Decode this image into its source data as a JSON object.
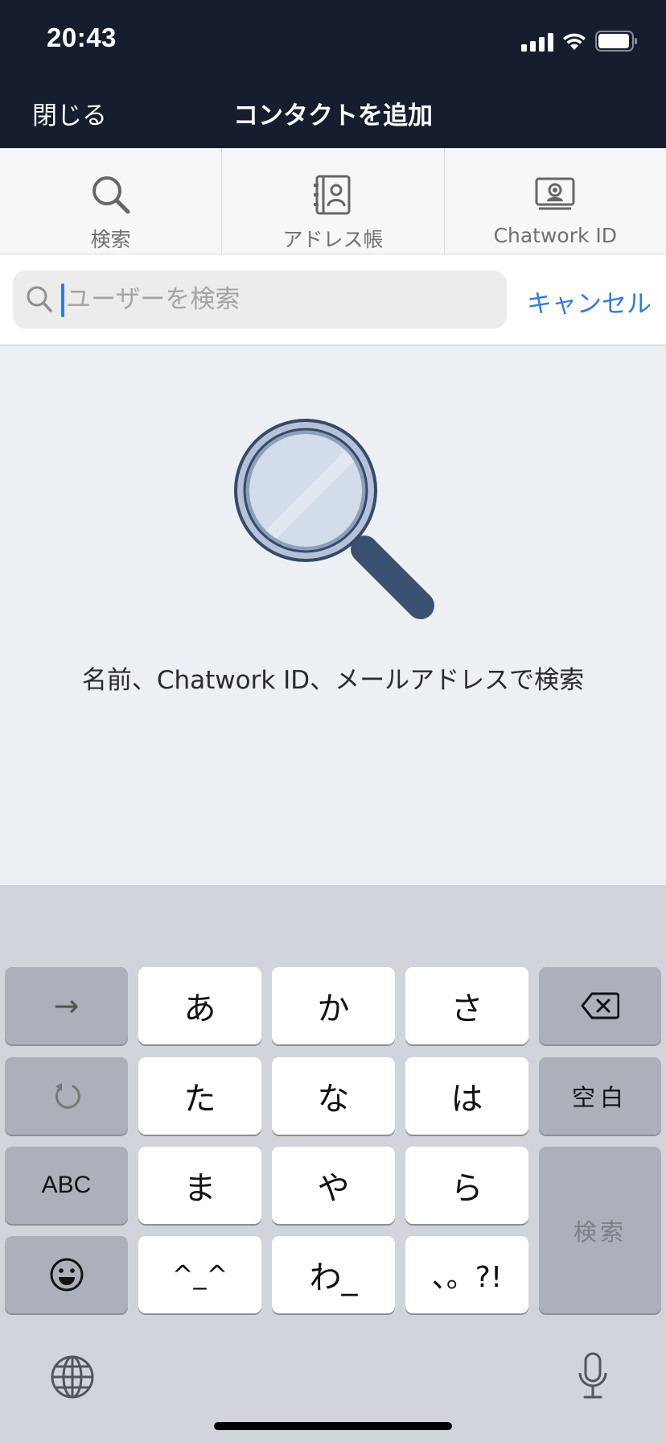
{
  "status_bar": {
    "time": "20:43"
  },
  "navbar": {
    "close_label": "閉じる",
    "title": "コンタクトを追加"
  },
  "tabs": [
    {
      "label": "検索",
      "icon": "search-icon"
    },
    {
      "label": "アドレス帳",
      "icon": "address-book-icon"
    },
    {
      "label": "Chatwork ID",
      "icon": "id-card-icon"
    }
  ],
  "search": {
    "placeholder": "ユーザーを検索",
    "value": "",
    "cancel_label": "キャンセル"
  },
  "empty_state": {
    "hint": "名前、Chatwork ID、メールアドレスで検索",
    "icon": "magnifier-illustration"
  },
  "keyboard": {
    "next_label": "→",
    "keys_row1": [
      "あ",
      "か",
      "さ"
    ],
    "keys_row2": [
      "た",
      "な",
      "は"
    ],
    "keys_row3": [
      "ま",
      "や",
      "ら"
    ],
    "keys_row4": [
      "^_^",
      "わ_",
      "、。?!"
    ],
    "space_label": "空白",
    "abc_label": "ABC",
    "search_label": "検索",
    "icons": [
      "delete-icon",
      "undo-icon",
      "emoji-icon",
      "globe-icon",
      "microphone-icon"
    ]
  },
  "colors": {
    "navbar_bg": "#151d2e",
    "accent": "#2f7ae5",
    "background": "#eceff4",
    "keyboard_bg": "#d1d4db"
  }
}
